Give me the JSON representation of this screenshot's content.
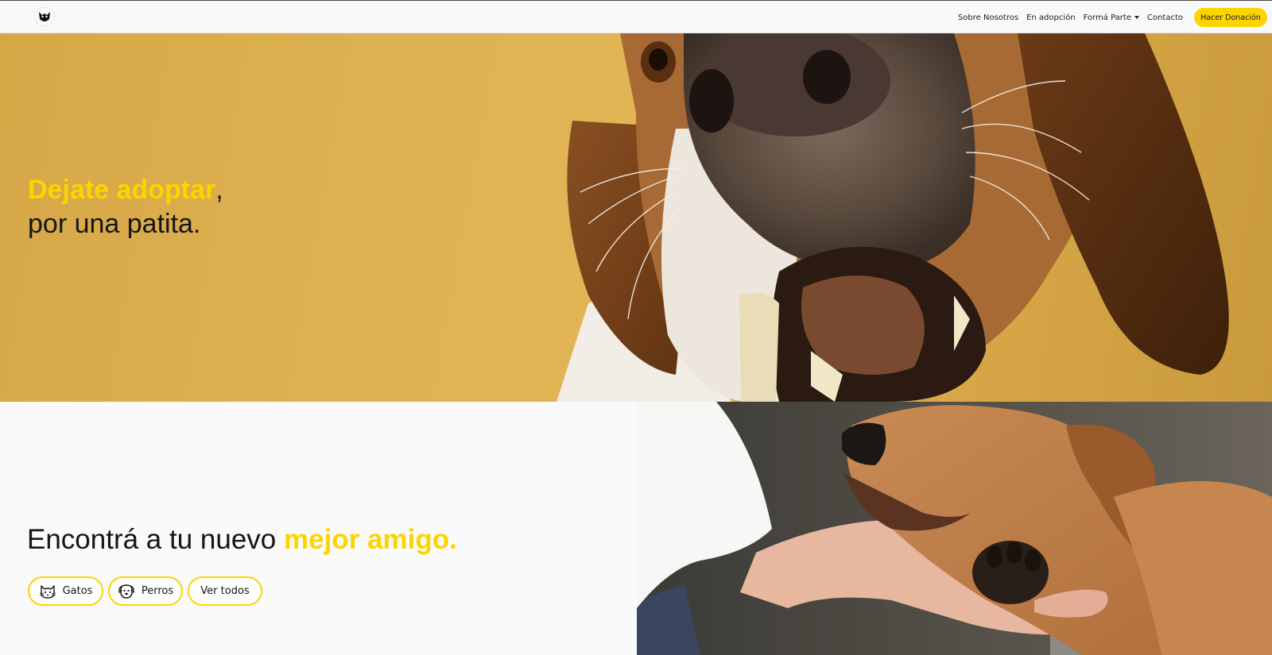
{
  "nav": {
    "logo": "logo-icon",
    "links": [
      "Sobre Nosotros",
      "En adopción",
      "Formá Parte",
      "Contacto"
    ],
    "donate_label": "Hacer Donación"
  },
  "hero": {
    "title_accent": "Dejate adoptar",
    "title_comma": ",",
    "title_line2": "por una patita."
  },
  "finder": {
    "title_plain": "Encontrá a tu nuevo ",
    "title_accent": "mejor amigo.",
    "buttons": {
      "cats": "Gatos",
      "dogs": "Perros",
      "all": "Ver todos"
    },
    "icons": [
      "cat-face-icon",
      "dog-face-icon"
    ]
  },
  "colors": {
    "accent": "#fcd400",
    "hero_bg": "#dfb354",
    "text": "#151515"
  }
}
